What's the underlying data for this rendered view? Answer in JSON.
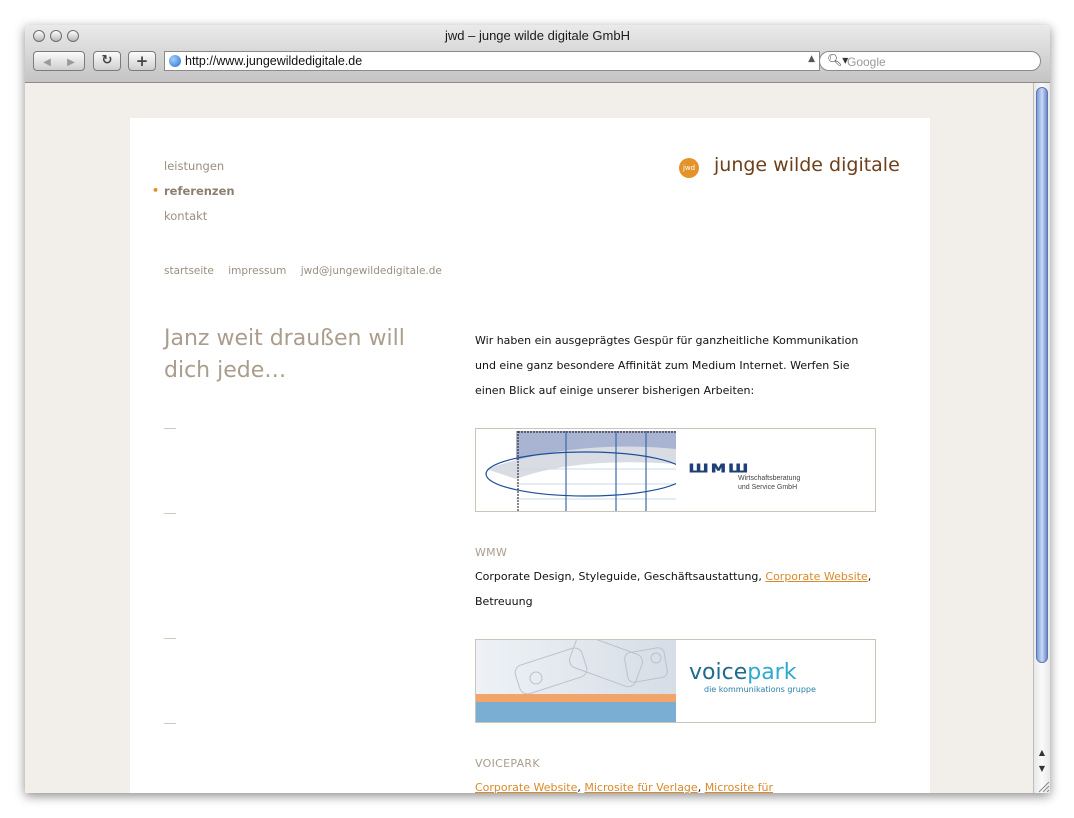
{
  "window": {
    "title": "jwd – junge wilde digitale GmbH",
    "url": "http://www.jungewildedigitale.de",
    "search_placeholder": "Google"
  },
  "nav": {
    "items": [
      {
        "label": "leistungen",
        "active": false
      },
      {
        "label": "referenzen",
        "active": true
      },
      {
        "label": "kontakt",
        "active": false
      }
    ]
  },
  "logo": {
    "badge": "jwd",
    "text": "junge wilde digitale",
    "color": "#e4922a"
  },
  "sublinks": [
    "startseite",
    "impressum",
    "jwd@jungewildedigitale.de"
  ],
  "headline": "Janz weit draußen will dich jede…",
  "intro": "Wir haben ein ausgeprägtes Gespür für ganzheitliche Kommunikation und eine ganz besondere Affinität zum Medium Internet. Werfen Sie einen Blick auf einige unserer bisherigen Arbeiten:",
  "references": [
    {
      "title": "WMW",
      "logo_text": "шмш",
      "logo_sub": [
        "Wirtschaftsberatung",
        "und Service GmbH"
      ],
      "desc_before": "Corporate Design, Styleguide, Geschäftsaustattung, ",
      "link": "Corporate Website",
      "desc_after": ", Betreuung"
    },
    {
      "title": "VOICEPARK",
      "logo_text_a": "voice",
      "logo_text_b": "park",
      "logo_sub": "die kommunikations gruppe",
      "links": [
        "Corporate Website",
        "Microsite für Verlage",
        "Microsite für"
      ]
    }
  ]
}
